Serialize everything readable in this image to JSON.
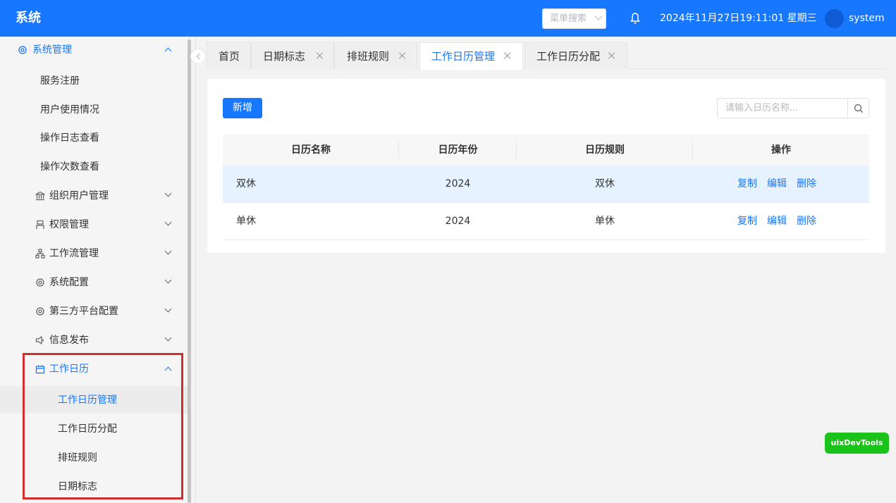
{
  "header": {
    "logo": "系统",
    "menu_search_placeholder": "菜单搜索",
    "datetime": "2024年11月27日19:11:01 星期三",
    "username": "system",
    "brand_color": "#1777fe"
  },
  "sidebar": {
    "group_title": "系统管理",
    "sub_items": [
      "服务注册",
      "用户使用情况",
      "操作日志查看",
      "操作次数查看"
    ],
    "menus": [
      {
        "label": "组织用户管理",
        "icon": "bank-icon"
      },
      {
        "label": "权限管理",
        "icon": "user-icon"
      },
      {
        "label": "工作流管理",
        "icon": "flow-icon"
      },
      {
        "label": "系统配置",
        "icon": "gear-icon"
      },
      {
        "label": "第三方平台配置",
        "icon": "gear-icon"
      },
      {
        "label": "信息发布",
        "icon": "megaphone-icon"
      }
    ],
    "calendar_menu": {
      "label": "工作日历",
      "children": [
        "工作日历管理",
        "工作日历分配",
        "排班规则",
        "日期标志"
      ],
      "active": "工作日历管理"
    }
  },
  "tabs": [
    {
      "label": "首页",
      "closable": false
    },
    {
      "label": "日期标志",
      "closable": true
    },
    {
      "label": "排班规则",
      "closable": true
    },
    {
      "label": "工作日历管理",
      "closable": true,
      "active": true
    },
    {
      "label": "工作日历分配",
      "closable": true
    }
  ],
  "toolbar": {
    "add_label": "新增",
    "search_placeholder": "请输入日历名称..."
  },
  "table": {
    "columns": [
      "日历名称",
      "日历年份",
      "日历规则",
      "操作"
    ],
    "rows": [
      {
        "name": "双休",
        "year": "2024",
        "rule": "双休"
      },
      {
        "name": "单休",
        "year": "2024",
        "rule": "单休"
      }
    ],
    "actions": [
      "复制",
      "编辑",
      "删除"
    ]
  },
  "devtools_label": "uixDevTools"
}
